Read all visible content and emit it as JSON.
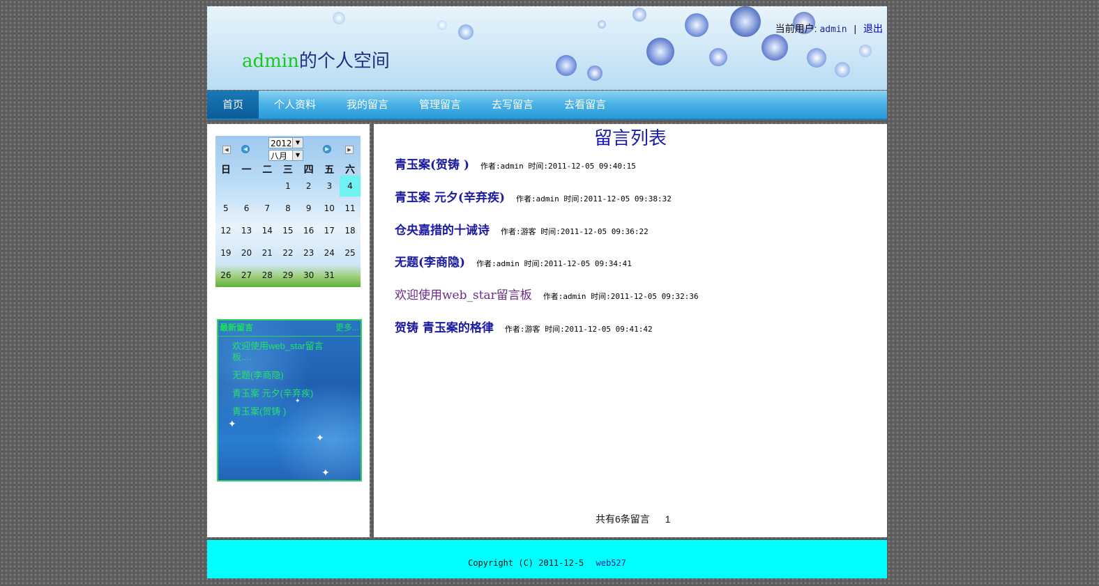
{
  "header": {
    "title_user": "admin",
    "title_suffix": "的个人空间",
    "current_user_label": "当前用户:",
    "current_user": "admin",
    "separator": "|",
    "logout_label": "退出"
  },
  "nav": {
    "items": [
      {
        "label": "首页"
      },
      {
        "label": "个人资料"
      },
      {
        "label": "我的留言"
      },
      {
        "label": "管理留言"
      },
      {
        "label": "去写留言"
      },
      {
        "label": "去看留言"
      }
    ],
    "active": "首页"
  },
  "calendar": {
    "year": "2012",
    "month": "八月",
    "weekdays": [
      "日",
      "一",
      "二",
      "三",
      "四",
      "五",
      "六"
    ],
    "weeks": [
      [
        "",
        "",
        "",
        "1",
        "2",
        "3",
        "4"
      ],
      [
        "5",
        "6",
        "7",
        "8",
        "9",
        "10",
        "11"
      ],
      [
        "12",
        "13",
        "14",
        "15",
        "16",
        "17",
        "18"
      ],
      [
        "19",
        "20",
        "21",
        "22",
        "23",
        "24",
        "25"
      ],
      [
        "26",
        "27",
        "28",
        "29",
        "30",
        "31",
        ""
      ]
    ],
    "today": "4"
  },
  "latest": {
    "title": "最新留言",
    "more": "更多...",
    "items": [
      "欢迎使用web_star留言板....",
      "无题(李商隐)",
      "青玉案 元夕(辛弃疾)",
      "青玉案(贺铸 )"
    ]
  },
  "main": {
    "list_title": "留言列表",
    "posts": [
      {
        "title": "青玉案(贺铸 )",
        "meta": "作者:admin  时间:2011-12-05 09:40:15"
      },
      {
        "title": "青玉案 元夕(辛弃疾)",
        "meta": "作者:admin  时间:2011-12-05 09:38:32"
      },
      {
        "title": "仓央嘉措的十诫诗",
        "meta": "作者:游客  时间:2011-12-05 09:36:22"
      },
      {
        "title": "无题(李商隐)",
        "meta": "作者:admin  时间:2011-12-05 09:34:41"
      },
      {
        "title": "欢迎使用web_star留言板",
        "meta": "作者:admin  时间:2011-12-05 09:32:36"
      },
      {
        "title": "贺铸 青玉案的格律",
        "meta": "作者:游客  时间:2011-12-05 09:41:42"
      }
    ],
    "pager_total": "共有6条留言",
    "pager_page": "1"
  },
  "footer": {
    "copyright": "Copyright (C) 2011-12-5",
    "brand": "web527"
  },
  "colors": {
    "footer_bg": "#00ffff",
    "title_user": "#19c81e",
    "link": "#1a1aa0",
    "visited": "#6b2a8a",
    "latest_text": "#23e36b"
  }
}
